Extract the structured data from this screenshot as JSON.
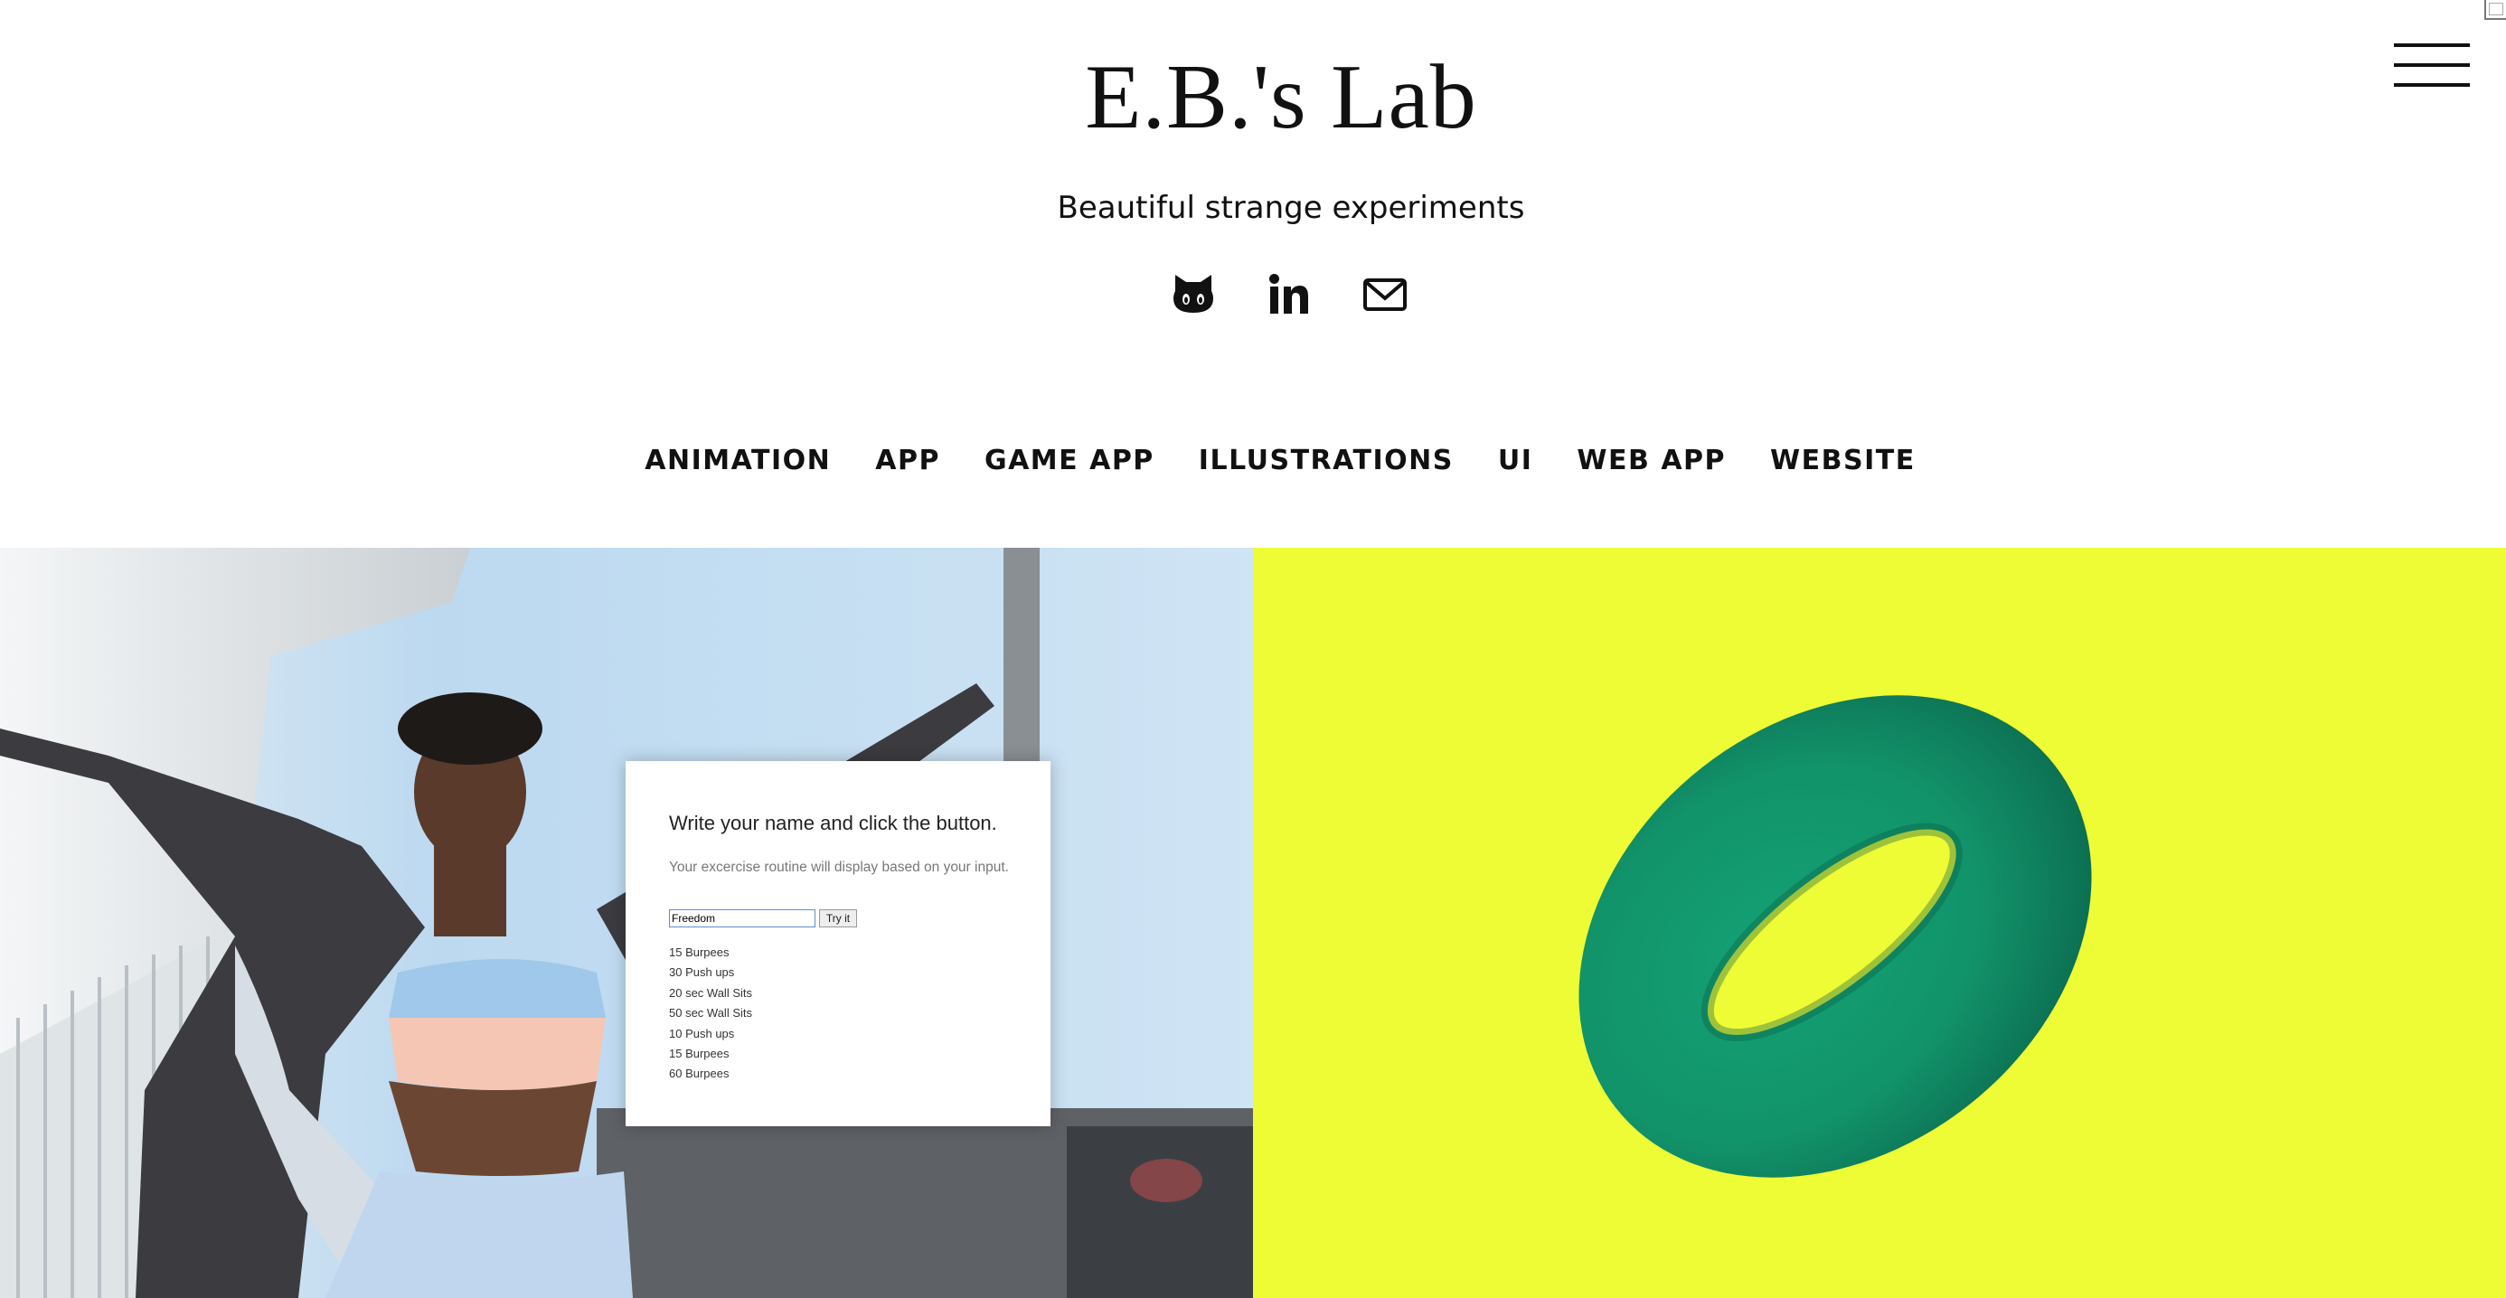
{
  "header": {
    "title": "E.B.'s Lab",
    "tagline": "Beautiful strange experiments"
  },
  "socials": [
    {
      "icon": "github-icon"
    },
    {
      "icon": "linkedin-icon"
    },
    {
      "icon": "mail-icon"
    }
  ],
  "nav": {
    "items": [
      "ANIMATION",
      "APP",
      "GAME APP",
      "ILLUSTRATIONS",
      "UI",
      "WEB APP",
      "WEBSITE"
    ]
  },
  "card": {
    "heading": "Write your name and click the button.",
    "description": "Your excercise routine will display based on your input.",
    "input_value": "Freedom",
    "button_label": "Try it",
    "routine": [
      "15 Burpees",
      "30 Push ups",
      "20 sec Wall Sits",
      "50 sec Wall Sits",
      "10 Push ups",
      "15 Burpees",
      "60 Burpees"
    ]
  },
  "colors": {
    "right_tile_background": "#eefc36",
    "torus": "#12936a",
    "text": "#111111"
  }
}
